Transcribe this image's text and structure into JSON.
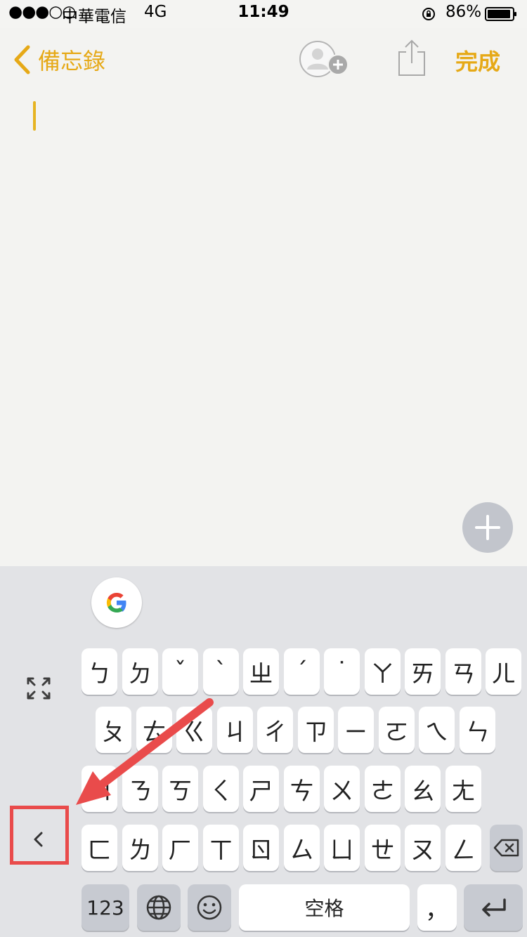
{
  "status_bar": {
    "signal": "●●●○○",
    "carrier": "中華電信",
    "network": "4G",
    "time": "11:49",
    "battery": "86%"
  },
  "nav": {
    "back_label": "備忘錄",
    "done_label": "完成"
  },
  "keyboard": {
    "rows": [
      [
        "ㄅ",
        "ㄉ",
        "ˇ",
        "ˋ",
        "ㄓ",
        "ˊ",
        "˙",
        "ㄚ",
        "ㄞ",
        "ㄢ",
        "ㄦ"
      ],
      [
        "ㄆ",
        "ㄊ",
        "ㄍ",
        "ㄐ",
        "ㄔ",
        "ㄗ",
        "ㄧ",
        "ㄛ",
        "ㄟ",
        "ㄣ"
      ],
      [
        "ㄇ",
        "ㄋ",
        "ㄎ",
        "ㄑ",
        "ㄕ",
        "ㄘ",
        "ㄨ",
        "ㄜ",
        "ㄠ",
        "ㄤ"
      ],
      [
        "ㄈ",
        "ㄌ",
        "ㄏ",
        "ㄒ",
        "ㄖ",
        "ㄙ",
        "ㄩ",
        "ㄝ",
        "ㄡ",
        "ㄥ"
      ]
    ],
    "numbers_label": "123",
    "space_label": "空格",
    "comma_label": "，"
  },
  "colors": {
    "accent": "#e6a917",
    "highlight": "#e94b4b"
  }
}
